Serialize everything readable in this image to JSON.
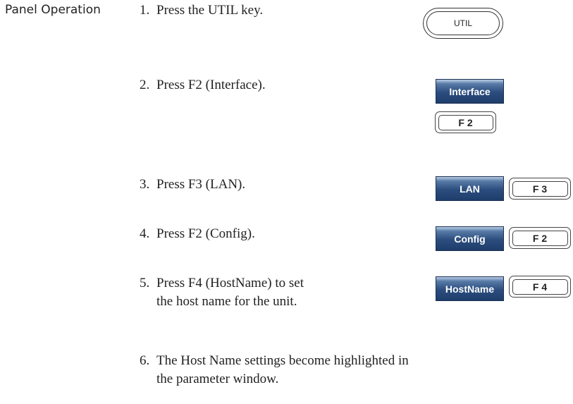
{
  "section_label": "Panel Operation",
  "steps": [
    {
      "num": "1.",
      "text": "Press the UTIL key."
    },
    {
      "num": "2.",
      "text": "Press F2 (Interface)."
    },
    {
      "num": "3.",
      "text": "Press F3 (LAN)."
    },
    {
      "num": "4.",
      "text": "Press F2 (Config)."
    },
    {
      "num": "5.",
      "line1": "Press F4 (HostName) to set",
      "line2": "the host name for the unit."
    },
    {
      "num": "6.",
      "line1": "The Host Name settings become highlighted in",
      "line2": "the parameter window."
    }
  ],
  "keys": {
    "util": "UTIL",
    "interface": "Interface",
    "f2_a": "F 2",
    "lan": "LAN",
    "f3": "F 3",
    "config": "Config",
    "f2_b": "F 2",
    "hostname": "HostName",
    "f4": "F 4"
  },
  "colors": {
    "softkey_blue": "#2b4d7e",
    "text": "#222222"
  }
}
